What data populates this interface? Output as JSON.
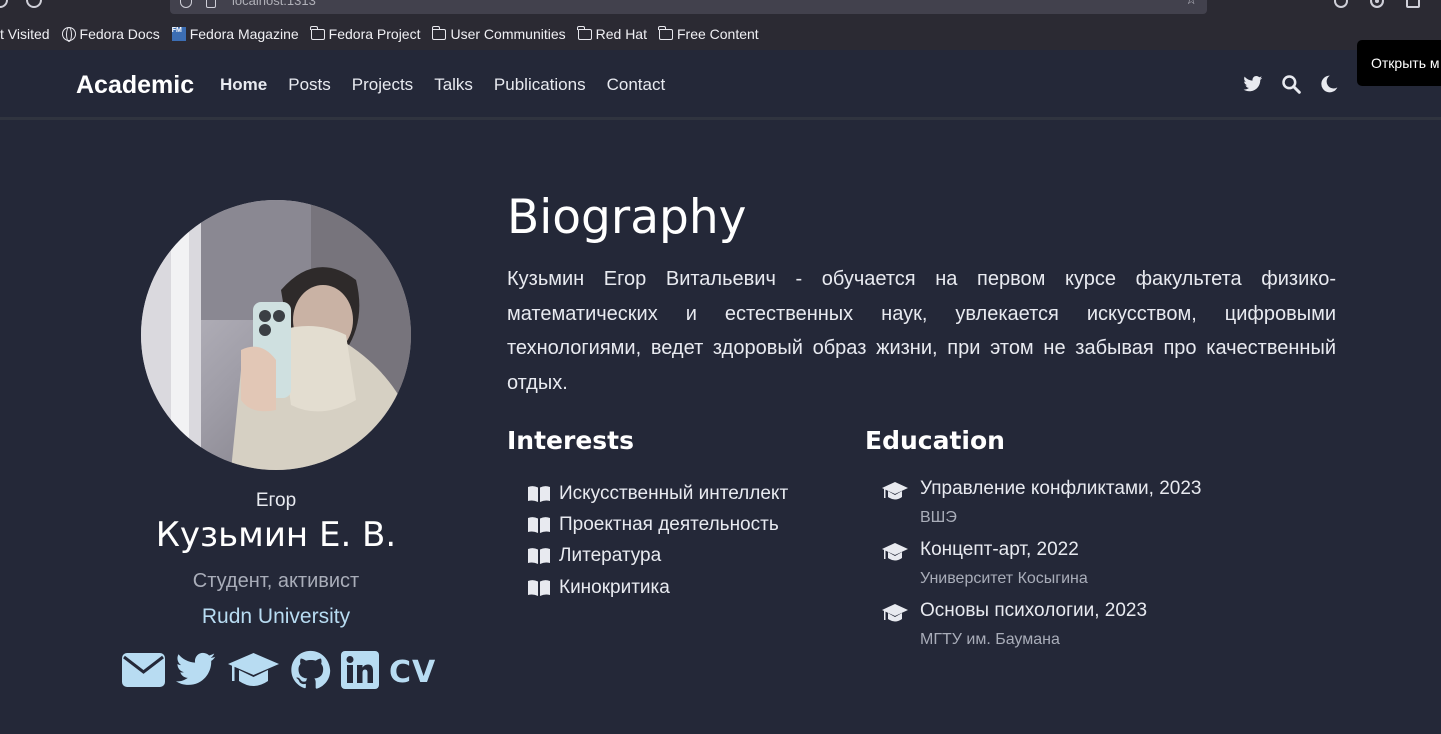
{
  "browser": {
    "url": "localhost:1313",
    "bookmarks": [
      {
        "label": "t Visited",
        "icon": "none"
      },
      {
        "label": "Fedora Docs",
        "icon": "globe-icon"
      },
      {
        "label": "Fedora Magazine",
        "icon": "fedora-magazine-icon"
      },
      {
        "label": "Fedora Project",
        "icon": "folder-icon"
      },
      {
        "label": "User Communities",
        "icon": "folder-icon"
      },
      {
        "label": "Red Hat",
        "icon": "folder-icon"
      },
      {
        "label": "Free Content",
        "icon": "folder-icon"
      }
    ],
    "tooltip": "Открыть м"
  },
  "navbar": {
    "brand": "Academic",
    "links": [
      "Home",
      "Posts",
      "Projects",
      "Talks",
      "Publications",
      "Contact"
    ],
    "active": "Home",
    "icons": [
      "twitter-icon",
      "search-icon",
      "moon-icon"
    ]
  },
  "profile": {
    "first_name": "Егор",
    "full_name": "Кузьмин Е. В.",
    "role": "Студент, активист",
    "organization": "Rudn University",
    "socials": [
      "email-icon",
      "twitter-icon",
      "graduation-cap-icon",
      "github-icon",
      "linkedin-icon",
      "cv-icon"
    ],
    "cv_label": "CV"
  },
  "biography": {
    "title": "Biography",
    "text": "Кузьмин Егор Витальевич - обучается на первом курсе факультета физико-математических и естественных наук, увлекается искусством, цифровыми технологиями, ведет здоровый образ жизни, при этом не забывая про качественный отдых."
  },
  "interests": {
    "title": "Interests",
    "items": [
      "Искусственный интеллект",
      "Проектная деятельность",
      "Литература",
      "Кинокритика"
    ]
  },
  "education": {
    "title": "Education",
    "items": [
      {
        "course": "Управление конфликтами, 2023",
        "institution": "ВШЭ"
      },
      {
        "course": "Концепт-арт, 2022",
        "institution": "Университет Косыгина"
      },
      {
        "course": "Основы психологии, 2023",
        "institution": "МГТУ им. Баумана"
      }
    ]
  },
  "colors": {
    "background": "#242838",
    "link": "#b8dcf2",
    "muted": "#a9adb9"
  }
}
